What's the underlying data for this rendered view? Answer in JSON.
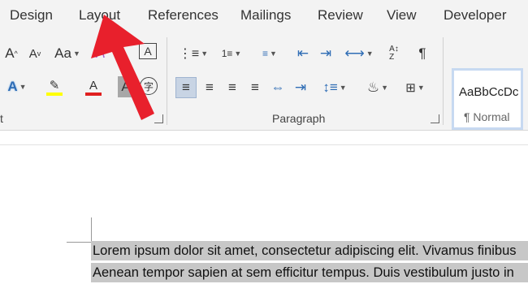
{
  "tabs": [
    "Design",
    "Layout",
    "References",
    "Mailings",
    "Review",
    "View",
    "Developer"
  ],
  "font_group": {
    "grow_font": "A",
    "shrink_font": "A",
    "change_case": "Aa",
    "clear_format": "A",
    "text_box": "A",
    "text_effects": "A",
    "highlight": "ab",
    "font_color": "A",
    "char_shading": "A",
    "enclose": "字",
    "label": "t"
  },
  "paragraph_group": {
    "label": "Paragraph"
  },
  "styles": {
    "preview": "AaBbCcDc",
    "name": "¶ Normal"
  },
  "colors": {
    "accent_arrow": "#e8202c",
    "highlight_yellow": "#ffff00",
    "font_red": "#e01f1f"
  },
  "document": {
    "line1": "Lorem ipsum dolor sit amet, consectetur adipiscing elit. Vivamus finibus",
    "line2": "Aenean tempor sapien at sem efficitur tempus. Duis vestibulum justo in"
  }
}
